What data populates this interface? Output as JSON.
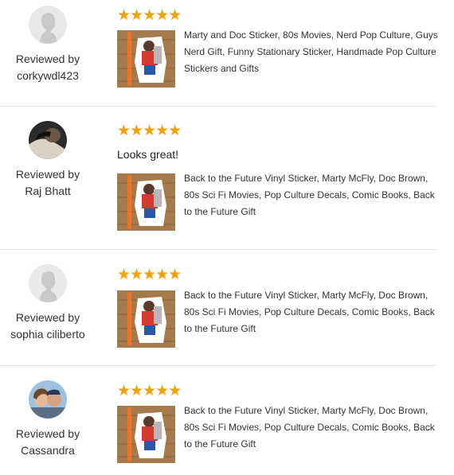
{
  "reviews": [
    {
      "reviewed_by_label": "Reviewed by",
      "reviewer_name": "corkywdl423",
      "avatar": "default-avatar",
      "rating": 5,
      "stars": "★★★★★",
      "review_text": "",
      "product_title": "Marty and Doc Sticker, 80s Movies, Nerd Pop Culture, Guys Nerd Gift, Funny Stationary Sticker, Handmade Pop Culture Stickers and Gifts"
    },
    {
      "reviewed_by_label": "Reviewed by",
      "reviewer_name": "Raj Bhatt",
      "avatar": "photo-avatar",
      "rating": 5,
      "stars": "★★★★★",
      "review_text": "Looks great!",
      "product_title": "Back to the Future Vinyl Sticker, Marty McFly, Doc Brown, 80s Sci Fi Movies, Pop Culture Decals, Comic Books, Back to the Future Gift"
    },
    {
      "reviewed_by_label": "Reviewed by",
      "reviewer_name": "sophia ciliberto",
      "avatar": "default-avatar",
      "rating": 5,
      "stars": "★★★★★",
      "review_text": "",
      "product_title": "Back to the Future Vinyl Sticker, Marty McFly, Doc Brown, 80s Sci Fi Movies, Pop Culture Decals, Comic Books, Back to the Future Gift"
    },
    {
      "reviewed_by_label": "Reviewed by",
      "reviewer_name": "Cassandra",
      "avatar": "photo-avatar",
      "rating": 5,
      "stars": "★★★★★",
      "review_text": "",
      "product_title": "Back to the Future Vinyl Sticker, Marty McFly, Doc Brown, 80s Sci Fi Movies, Pop Culture Decals, Comic Books, Back to the Future Gift"
    }
  ],
  "colors": {
    "star": "#f1a10a",
    "divider": "#e1e1e1",
    "text": "#333333"
  }
}
